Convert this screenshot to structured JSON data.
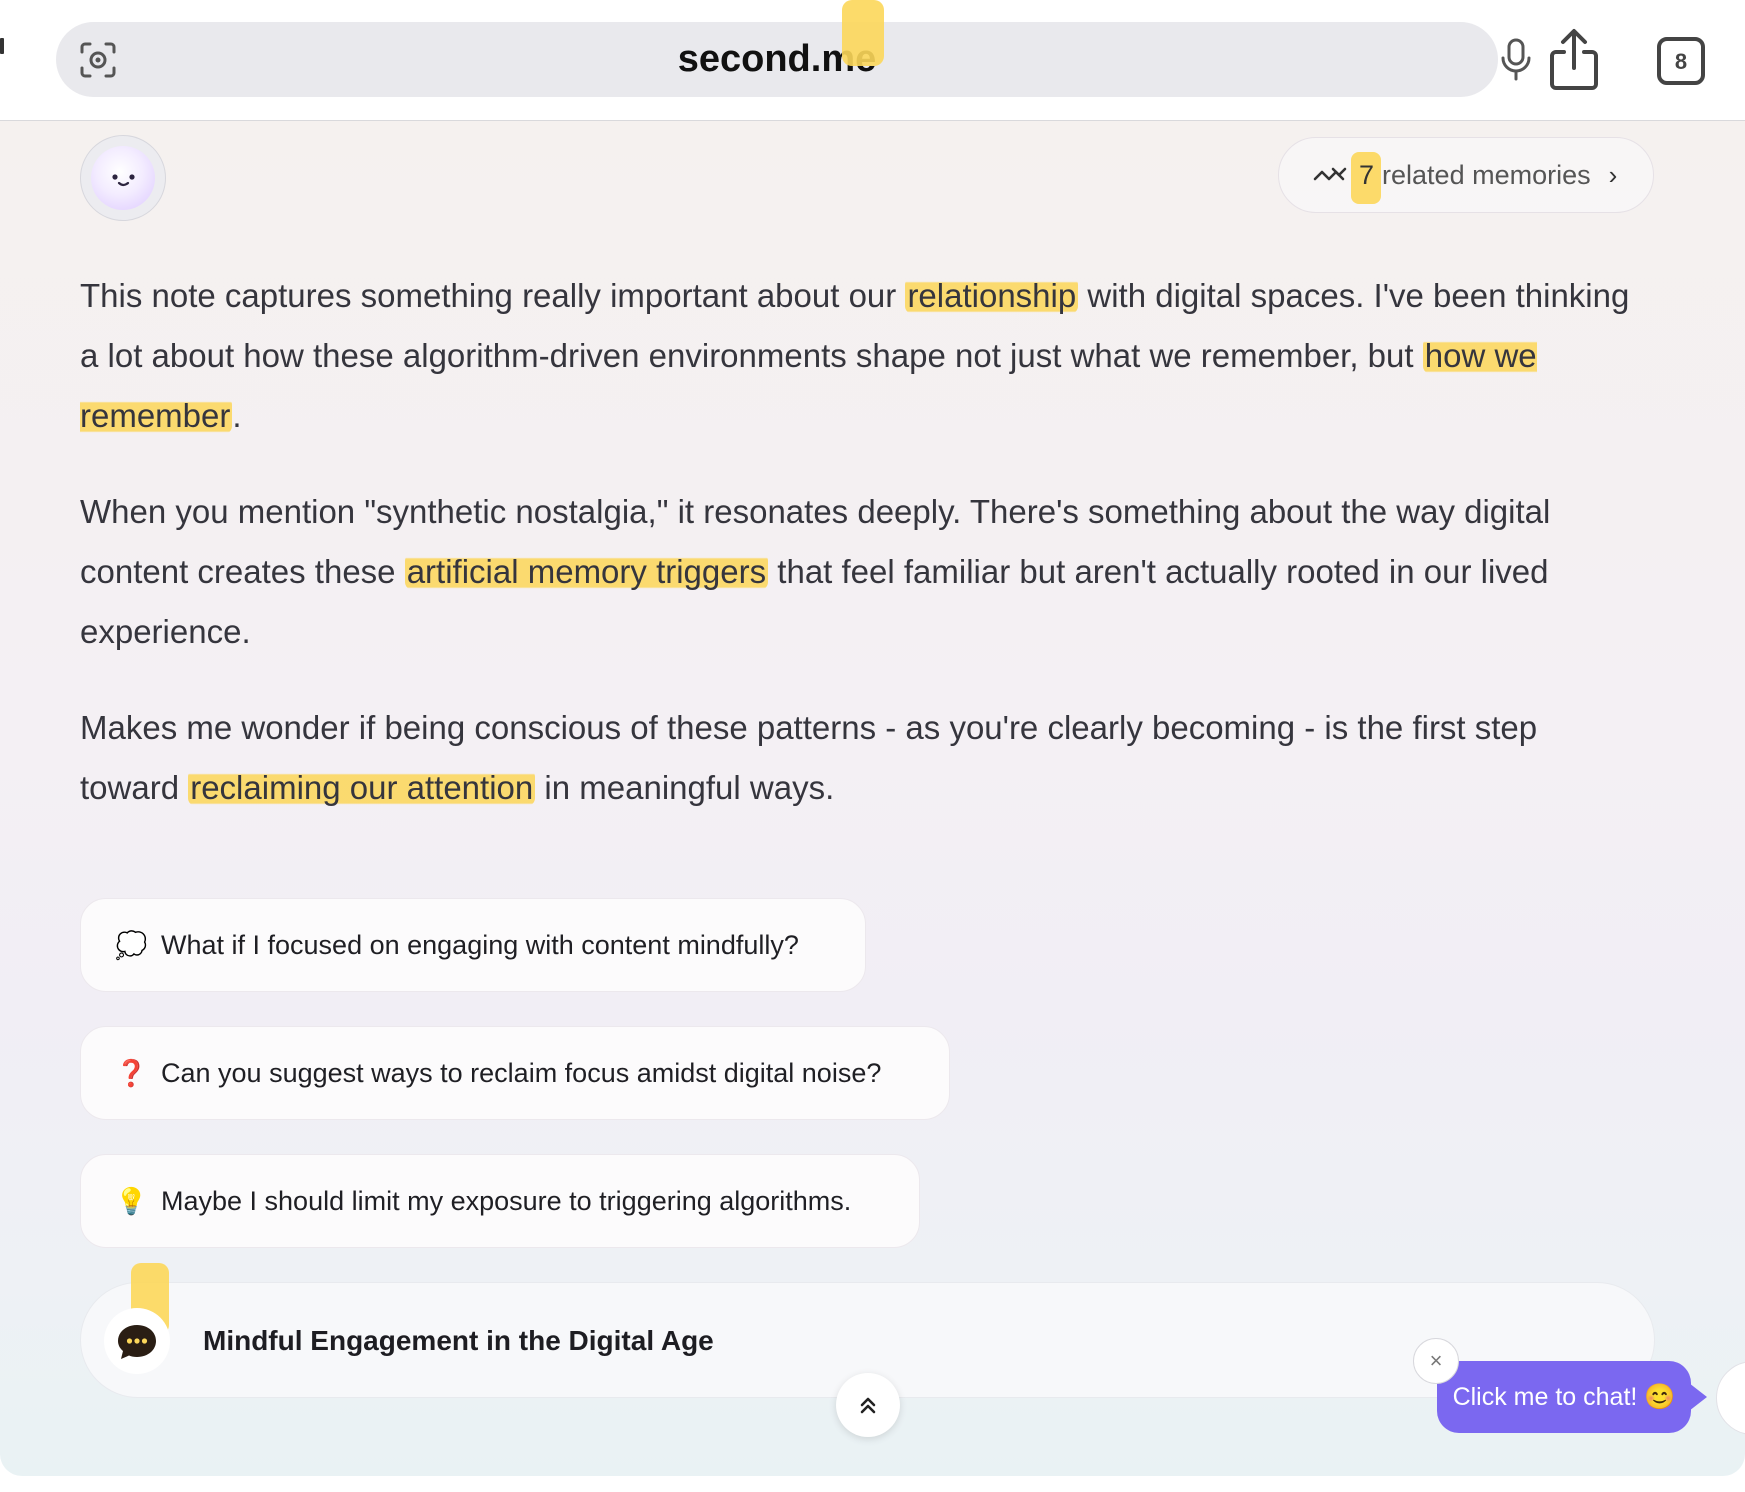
{
  "browser": {
    "url": "second.me",
    "tab_count": "8",
    "icons": [
      "lens-icon",
      "microphone-icon",
      "share-icon",
      "tabs-icon"
    ]
  },
  "header": {
    "avatar_icon": "smiley-avatar-icon",
    "related": {
      "count": "7",
      "label": "related memories",
      "chevron": "›"
    }
  },
  "message": {
    "paragraphs": [
      {
        "segments": [
          {
            "text": "This note captures something really important about our ",
            "hl": false
          },
          {
            "text": "relationship",
            "hl": true
          },
          {
            "text": " with digital spaces. I've been thinking a lot about how these algorithm-driven environments shape not just what we remember, but ",
            "hl": false
          },
          {
            "text": "how we remember",
            "hl": true
          },
          {
            "text": ".",
            "hl": false
          }
        ]
      },
      {
        "segments": [
          {
            "text": "When you mention \"synthetic nostalgia,\" it resonates deeply. There's something about the way digital content creates these ",
            "hl": false
          },
          {
            "text": "artificial memory triggers",
            "hl": true
          },
          {
            "text": " that feel familiar but aren't actually rooted in our lived experience.",
            "hl": false
          }
        ]
      },
      {
        "segments": [
          {
            "text": "Makes me wonder if being conscious of these patterns - as you're clearly becoming - is the first step toward ",
            "hl": false
          },
          {
            "text": "reclaiming our attention",
            "hl": true
          },
          {
            "text": " in meaningful ways.",
            "hl": false
          }
        ]
      }
    ]
  },
  "suggestions": [
    {
      "emoji": "💭",
      "icon": "thought-bubble-icon",
      "text": "What if I focused on engaging with content mindfully?"
    },
    {
      "emoji": "❓",
      "icon": "question-mark-icon",
      "text": "Can you suggest ways to reclaim focus amidst digital noise?"
    },
    {
      "emoji": "💡",
      "icon": "lightbulb-icon",
      "text": "Maybe I should limit my exposure to triggering algorithms."
    }
  ],
  "topic": {
    "title": "Mindful Engagement in the Digital Age",
    "icon": "chat-bubble-icon"
  },
  "chat_prompt": {
    "label": "Click me to chat! 😊",
    "close": "×"
  },
  "colors": {
    "highlight": "#fcd75a",
    "cta": "#7b68f0",
    "text": "#35353d"
  }
}
